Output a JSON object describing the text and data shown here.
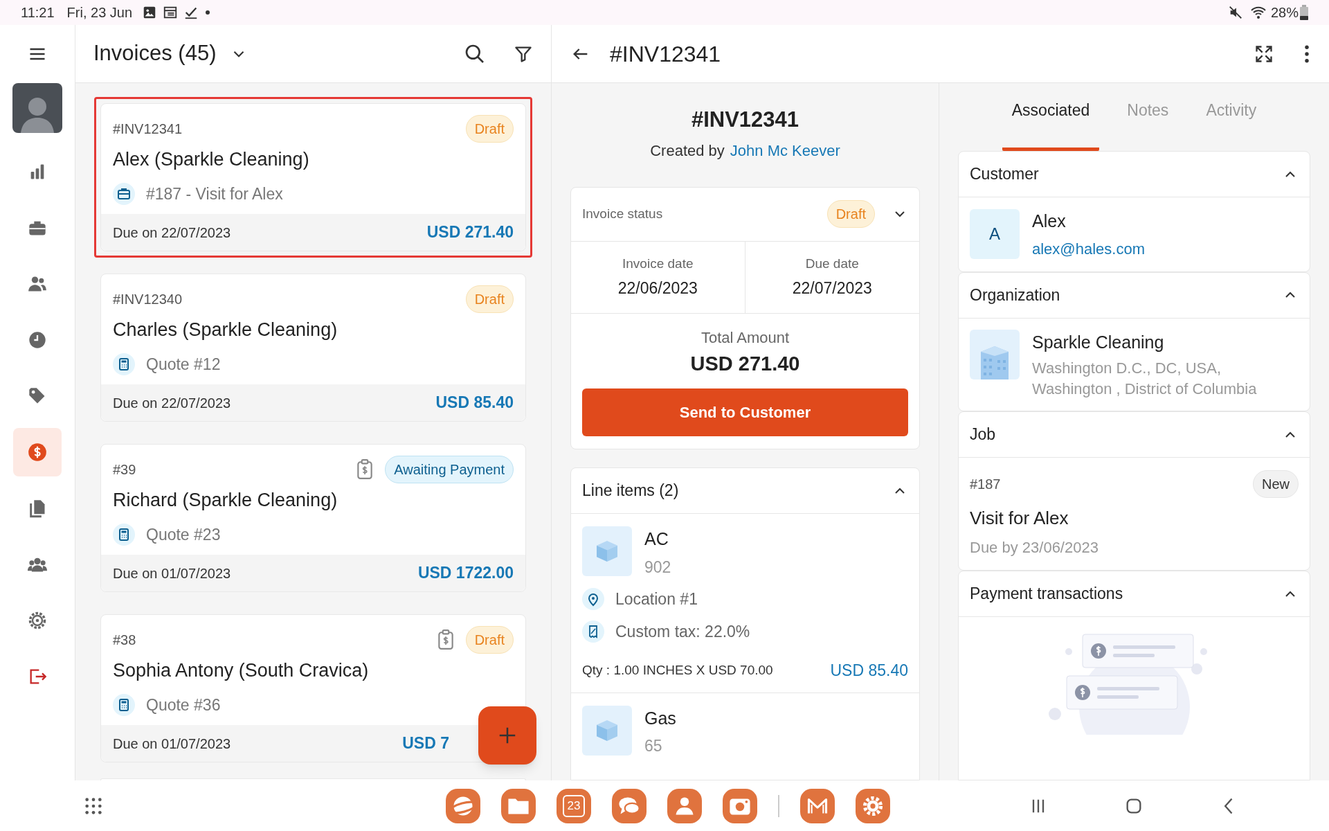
{
  "status_bar": {
    "time": "11:21",
    "date": "Fri, 23 Jun",
    "battery": "28%"
  },
  "rail": {
    "items": [
      {
        "selected": false
      },
      {
        "selected": false
      },
      {
        "selected": false
      },
      {
        "selected": false
      },
      {
        "selected": false
      },
      {
        "selected": true
      },
      {
        "selected": false
      },
      {
        "selected": false
      },
      {
        "selected": false
      },
      {
        "selected": false
      }
    ]
  },
  "list": {
    "title": "Invoices (45)",
    "cards": [
      {
        "number": "#INV12341",
        "badge": {
          "kind": "draft",
          "label": "Draft"
        },
        "payment_icon": false,
        "name": "Alex (Sparkle Cleaning)",
        "reference": {
          "kind": "job",
          "text": "#187 - Visit for Alex"
        },
        "due": "Due on 22/07/2023",
        "amount": "USD 271.40",
        "selected": true
      },
      {
        "number": "#INV12340",
        "badge": {
          "kind": "draft",
          "label": "Draft"
        },
        "payment_icon": false,
        "name": "Charles (Sparkle Cleaning)",
        "reference": {
          "kind": "quote",
          "text": "Quote #12"
        },
        "due": "Due on 22/07/2023",
        "amount": "USD 85.40",
        "selected": false
      },
      {
        "number": "#39",
        "badge": {
          "kind": "awaiting",
          "label": "Awaiting Payment"
        },
        "payment_icon": true,
        "name": "Richard (Sparkle Cleaning)",
        "reference": {
          "kind": "quote",
          "text": "Quote #23"
        },
        "due": "Due on 01/07/2023",
        "amount": "USD 1722.00",
        "selected": false
      },
      {
        "number": "#38",
        "badge": {
          "kind": "draft",
          "label": "Draft"
        },
        "payment_icon": true,
        "name": "Sophia Antony (South Cravica)",
        "reference": {
          "kind": "quote",
          "text": "Quote #36"
        },
        "due": "Due on 01/07/2023",
        "amount": "USD 7",
        "selected": false
      }
    ]
  },
  "detail": {
    "title": "#INV12341",
    "heading": "#INV12341",
    "created_label": "Created by",
    "created_by": "John Mc Keever",
    "status_label": "Invoice status",
    "status": "Draft",
    "invoice_date_label": "Invoice date",
    "invoice_date": "22/06/2023",
    "due_date_label": "Due date",
    "due_date": "22/07/2023",
    "total_label": "Total Amount",
    "total": "USD 271.40",
    "send_button": "Send to Customer",
    "line_items": {
      "title": "Line items (2)",
      "expanded": true,
      "items": [
        {
          "name": "AC",
          "code": "902",
          "location": "Location #1",
          "tax": "Custom tax: 22.0%",
          "qty": "Qty : 1.00 INCHES X USD 70.00",
          "amount": "USD 85.40"
        },
        {
          "name": "Gas",
          "code": "65"
        }
      ]
    }
  },
  "side": {
    "tabs": [
      {
        "label": "Associated",
        "selected": true
      },
      {
        "label": "Notes",
        "selected": false
      },
      {
        "label": "Activity",
        "selected": false
      }
    ],
    "customer": {
      "title": "Customer",
      "expanded": true,
      "initial": "A",
      "name": "Alex",
      "email": "alex@hales.com"
    },
    "organization": {
      "title": "Organization",
      "expanded": true,
      "name": "Sparkle Cleaning",
      "address_lines": [
        "Washington D.C., DC, USA,",
        "Washington , District of Columbia"
      ]
    },
    "job": {
      "title": "Job",
      "expanded": true,
      "number": "#187",
      "status": "New",
      "name": "Visit for Alex",
      "due": "Due by 23/06/2023"
    },
    "payments": {
      "title": "Payment transactions",
      "expanded": true
    }
  },
  "dock": {
    "calendar_day": "23"
  }
}
